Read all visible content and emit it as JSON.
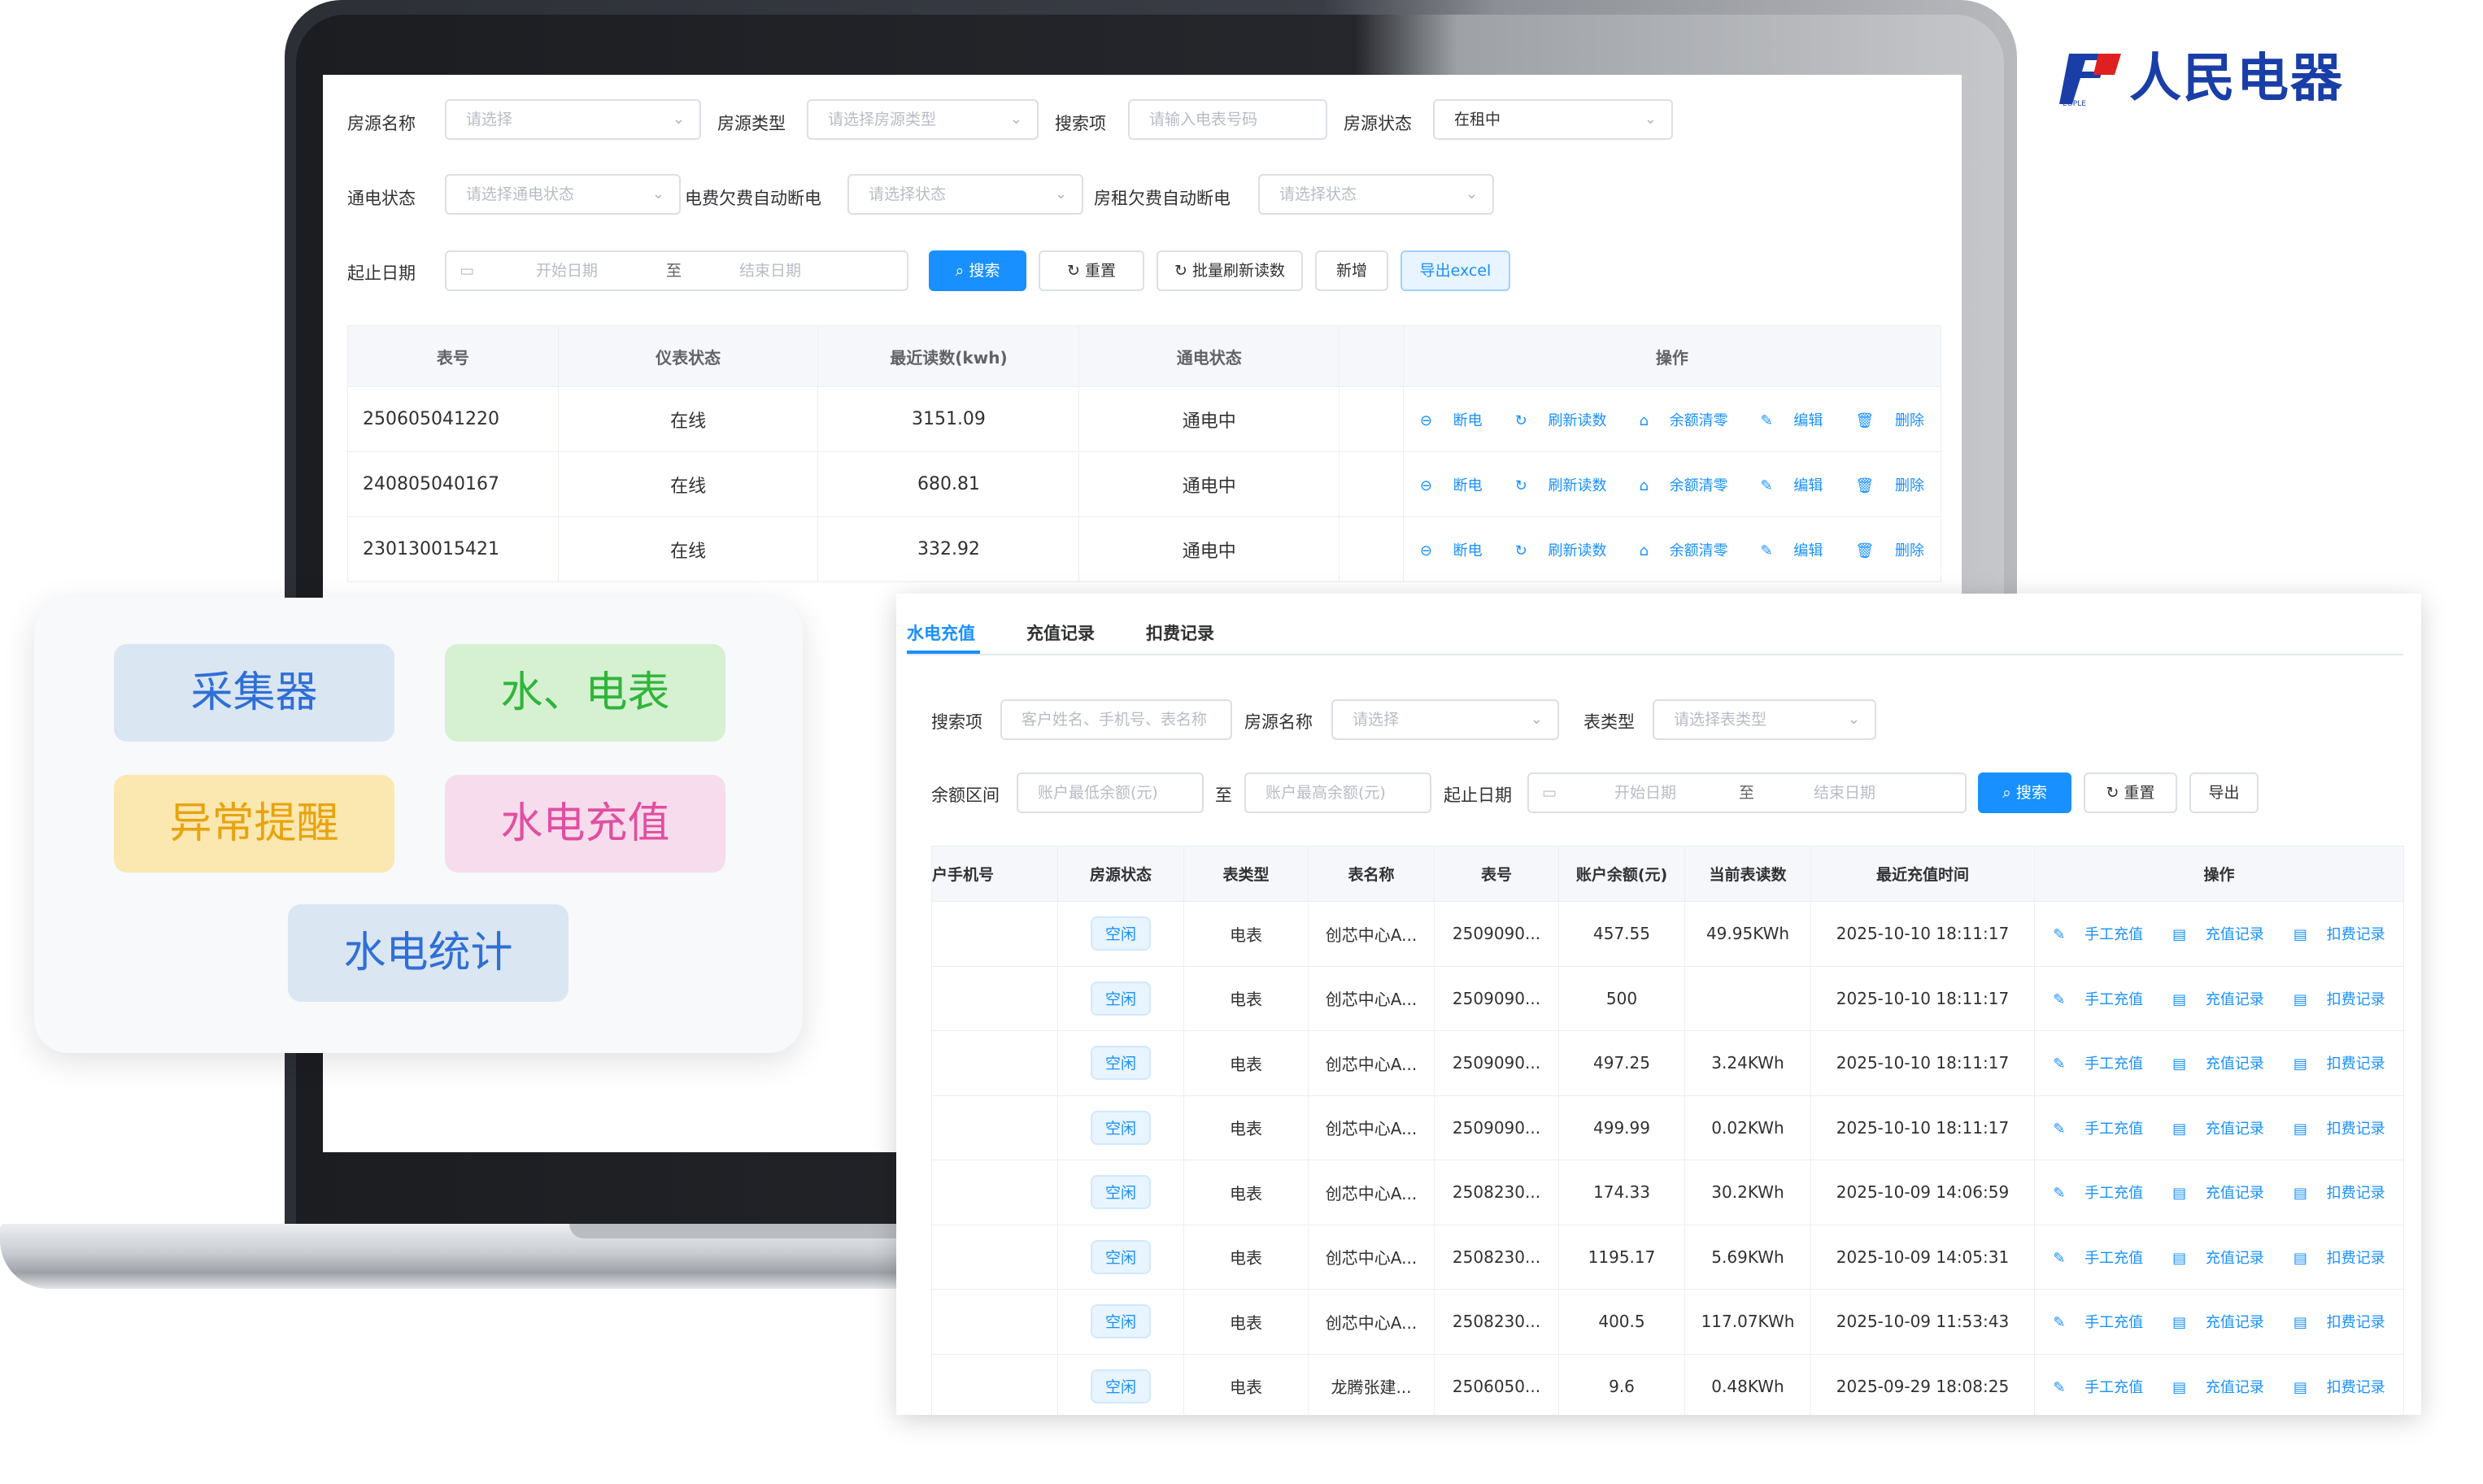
{
  "brand": {
    "name": "人民电器",
    "mark_letters": "PEOPLE"
  },
  "back_window": {
    "filters": {
      "room_name_label": "房源名称",
      "room_name_placeholder": "请选择",
      "room_type_label": "房源类型",
      "room_type_placeholder": "请选择房源类型",
      "search_item_label": "搜索项",
      "search_item_placeholder": "请输入电表号码",
      "room_status_label": "房源状态",
      "room_status_value": "在租中",
      "power_status_label": "通电状态",
      "power_status_placeholder": "请选择通电状态",
      "fee_cutoff_label": "电费欠费自动断电",
      "fee_cutoff_placeholder": "请选择状态",
      "rent_cutoff_label": "房租欠费自动断电",
      "rent_cutoff_placeholder": "请选择状态",
      "date_label": "起止日期",
      "date_start": "开始日期",
      "date_sep": "至",
      "date_end": "结束日期"
    },
    "buttons": {
      "search": "搜索",
      "reset": "重置",
      "batch_refresh": "批量刷新读数",
      "add": "新增",
      "export": "导出excel"
    },
    "table": {
      "headers": [
        "表号",
        "仪表状态",
        "最近读数(kwh)",
        "通电状态",
        "",
        "操作"
      ],
      "rows": [
        {
          "meter": "250605041220",
          "status": "在线",
          "reading": "3151.09",
          "power": "通电中"
        },
        {
          "meter": "240805040167",
          "status": "在线",
          "reading": "680.81",
          "power": "通电中"
        },
        {
          "meter": "230130015421",
          "status": "在线",
          "reading": "332.92",
          "power": "通电中"
        }
      ],
      "actions": [
        "断电",
        "刷新读数",
        "余额清零",
        "编辑",
        "删除"
      ]
    }
  },
  "features": [
    "采集器",
    "水、电表",
    "异常提醒",
    "水电充值",
    "水电统计"
  ],
  "front_window": {
    "tabs": [
      "水电充值",
      "充值记录",
      "扣费记录"
    ],
    "filters": {
      "search_label": "搜索项",
      "search_placeholder": "客户姓名、手机号、表名称",
      "room_label": "房源名称",
      "room_placeholder": "请选择",
      "meter_type_label": "表类型",
      "meter_type_placeholder": "请选择表类型",
      "balance_label": "余额区间",
      "balance_min": "账户最低余额(元)",
      "balance_sep": "至",
      "balance_max": "账户最高余额(元)",
      "date_label": "起止日期",
      "date_start": "开始日期",
      "date_sep": "至",
      "date_end": "结束日期"
    },
    "buttons": {
      "search": "搜索",
      "reset": "重置",
      "export": "导出"
    },
    "table": {
      "headers": [
        "户手机号",
        "房源状态",
        "表类型",
        "表名称",
        "表号",
        "账户余额(元)",
        "当前表读数",
        "最近充值时间",
        "操作"
      ],
      "rows": [
        {
          "phone": "",
          "room_status": "空闲",
          "type": "电表",
          "name": "创芯中心A...",
          "meter": "2509090...",
          "balance": "457.55",
          "reading": "49.95KWh",
          "time": "2025-10-10 18:11:17"
        },
        {
          "phone": "",
          "room_status": "空闲",
          "type": "电表",
          "name": "创芯中心A...",
          "meter": "2509090...",
          "balance": "500",
          "reading": "",
          "time": "2025-10-10 18:11:17"
        },
        {
          "phone": "",
          "room_status": "空闲",
          "type": "电表",
          "name": "创芯中心A...",
          "meter": "2509090...",
          "balance": "497.25",
          "reading": "3.24KWh",
          "time": "2025-10-10 18:11:17"
        },
        {
          "phone": "",
          "room_status": "空闲",
          "type": "电表",
          "name": "创芯中心A...",
          "meter": "2509090...",
          "balance": "499.99",
          "reading": "0.02KWh",
          "time": "2025-10-10 18:11:17"
        },
        {
          "phone": "",
          "room_status": "空闲",
          "type": "电表",
          "name": "创芯中心A...",
          "meter": "2508230...",
          "balance": "174.33",
          "reading": "30.2KWh",
          "time": "2025-10-09 14:06:59"
        },
        {
          "phone": "",
          "room_status": "空闲",
          "type": "电表",
          "name": "创芯中心A...",
          "meter": "2508230...",
          "balance": "1195.17",
          "reading": "5.69KWh",
          "time": "2025-10-09 14:05:31"
        },
        {
          "phone": "",
          "room_status": "空闲",
          "type": "电表",
          "name": "创芯中心A...",
          "meter": "2508230...",
          "balance": "400.5",
          "reading": "117.07KWh",
          "time": "2025-10-09 11:53:43"
        },
        {
          "phone": "",
          "room_status": "空闲",
          "type": "电表",
          "name": "龙腾张建...",
          "meter": "2506050...",
          "balance": "9.6",
          "reading": "0.48KWh",
          "time": "2025-09-29 18:08:25"
        }
      ],
      "actions": [
        "手工充值",
        "充值记录",
        "扣费记录"
      ]
    }
  },
  "colors": {
    "primary": "#1890ff",
    "brand": "#1a3ea8",
    "brand_red": "#e02020"
  }
}
